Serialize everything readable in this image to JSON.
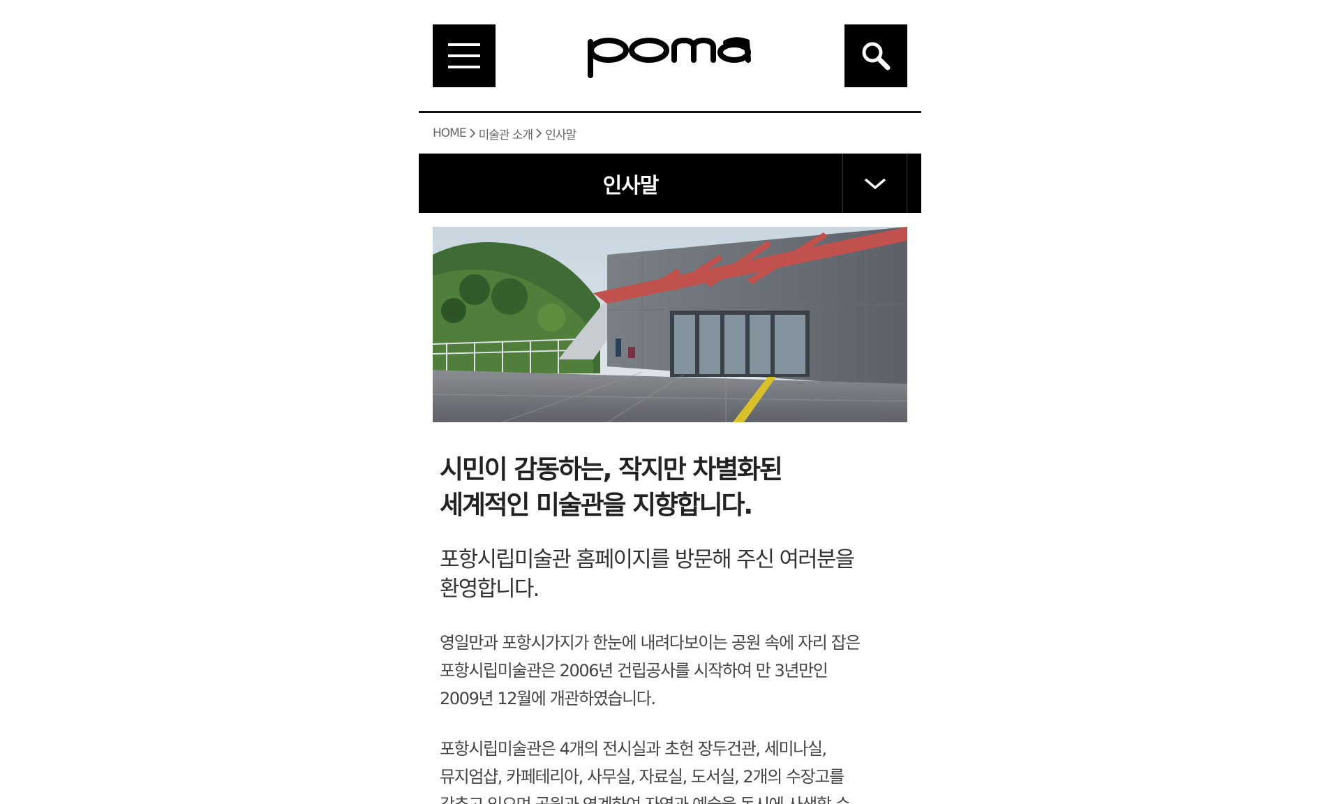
{
  "header": {
    "logo_text": "poma",
    "menu_icon": "hamburger-icon",
    "search_icon": "search-icon"
  },
  "breadcrumb": {
    "items": [
      "HOME",
      "미술관 소개",
      "인사말"
    ]
  },
  "title_bar": {
    "title": "인사말",
    "dropdown_icon": "chevron-down-icon"
  },
  "hero": {
    "alt": "포항시립미술관 전경"
  },
  "content": {
    "headline": [
      "시민이 감동하는, 작지만 차별화된",
      "세계적인 미술관을 지향합니다."
    ],
    "lead": [
      "포항시립미술관 홈페이지를 방문해 주신 여러분을",
      "환영합니다."
    ],
    "paragraph1": [
      "영일만과 포항시가지가 한눈에 내려다보이는 공원 속에 자리 잡은",
      "포항시립미술관은 2006년 건립공사를 시작하여 만 3년만인",
      "2009년 12월에 개관하였습니다."
    ],
    "paragraph2": [
      "포항시립미술관은 4개의 전시실과 초헌 장두건관, 세미나실,",
      "뮤지엄샵, 카페테리아, 사무실, 자료실, 도서실, 2개의 수장고를",
      "갖추고 있으며 공원과 연계하여 자연과 예술을 동시에 사색할 수"
    ]
  },
  "colors": {
    "header_button_bg": "#000000",
    "title_bar_bg": "#000000",
    "canopy_red": "#c0514d"
  }
}
